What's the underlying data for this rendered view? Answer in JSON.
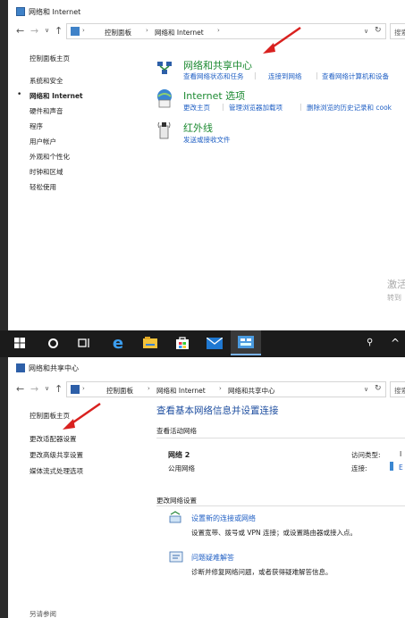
{
  "window1": {
    "title": "网络和 Internet",
    "breadcrumb": [
      "控制面板",
      "网络和 Internet"
    ],
    "search_placeholder": "搜索",
    "sidebar": [
      "控制面板主页",
      "系统和安全",
      "网络和 Internet",
      "硬件和声音",
      "程序",
      "用户帐户",
      "外观和个性化",
      "时钟和区域",
      "轻松使用"
    ],
    "active_sidebar_index": 2,
    "categories": [
      {
        "title": "网络和共享中心",
        "links": [
          "查看网络状态和任务",
          "连接到网络",
          "查看网络计算机和设备"
        ]
      },
      {
        "title": "Internet 选项",
        "links": [
          "更改主页",
          "管理浏览器加载项",
          "删除浏览的历史记录和 cook"
        ]
      },
      {
        "title": "红外线",
        "links": [
          "发送或接收文件"
        ]
      }
    ],
    "watermark": [
      "激活",
      "转到"
    ]
  },
  "taskbar": {
    "icons": [
      "windows-icon",
      "search-circle-icon",
      "task-view-icon",
      "edge-icon",
      "file-explorer-icon",
      "store-icon",
      "mail-icon",
      "control-panel-icon",
      "people-icon",
      "chevron-up-icon"
    ],
    "tray_text": "^"
  },
  "window2": {
    "title": "网络和共享中心",
    "breadcrumb": [
      "控制面板",
      "网络和 Internet",
      "网络和共享中心"
    ],
    "search_placeholder": "搜索",
    "sidebar": [
      "控制面板主页",
      "更改适配器设置",
      "更改高级共享设置",
      "媒体流式处理选项"
    ],
    "heading": "查看基本网络信息并设置连接",
    "active_networks_label": "查看活动网络",
    "network": {
      "name": "网络 2",
      "type": "公用网络",
      "access_label": "访问类型:",
      "access_value": "I",
      "connection_label": "连接:",
      "connection_value": "E"
    },
    "change_settings_label": "更改网络设置",
    "tasks": [
      {
        "title": "设置新的连接或网络",
        "desc": "设置宽带、拨号或 VPN 连接；或设置路由器或接入点。"
      },
      {
        "title": "问题疑难解答",
        "desc": "诊断并修复网络问题，或者获得疑难解答信息。"
      }
    ],
    "see_also": "另请参阅"
  },
  "colors": {
    "green_title": "#1d8a32",
    "link_blue": "#1f5fc4",
    "taskbar_bg": "#1b1b1b",
    "arrow_red": "#d9211f"
  }
}
